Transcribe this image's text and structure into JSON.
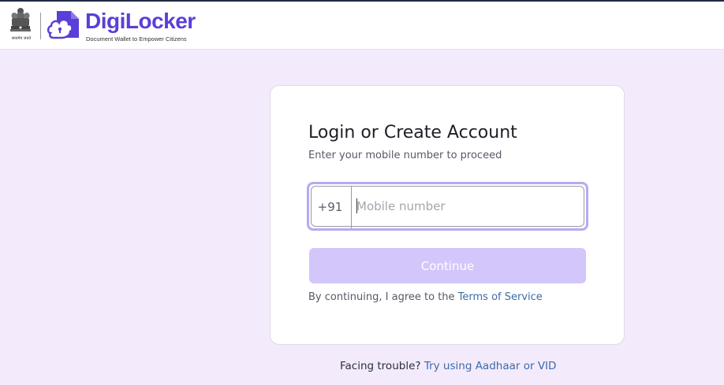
{
  "header": {
    "emblem_caption": "सत्यमेव जयते",
    "brand_name": "DigiLocker",
    "brand_tagline": "Document Wallet to Empower Citizens",
    "emblem_icon": "national-emblem-icon",
    "logo_icon": "digilocker-logo-icon",
    "brand_color": "#5b3fd6"
  },
  "login": {
    "title": "Login or Create Account",
    "subtitle": "Enter your mobile number to proceed",
    "country_code": "+91",
    "mobile_value": "",
    "mobile_placeholder": "Mobile number",
    "continue_label": "Continue",
    "terms_prefix": "By continuing, I agree to the ",
    "terms_link": "Terms of Service"
  },
  "footer": {
    "trouble_text": "Facing trouble? ",
    "trouble_link": "Try using Aadhaar or VID"
  },
  "colors": {
    "page_bg": "#f3ebfc",
    "button_disabled": "#d3c6fb",
    "focus_ring": "#b8a8f0",
    "link": "#3d6aa8"
  }
}
